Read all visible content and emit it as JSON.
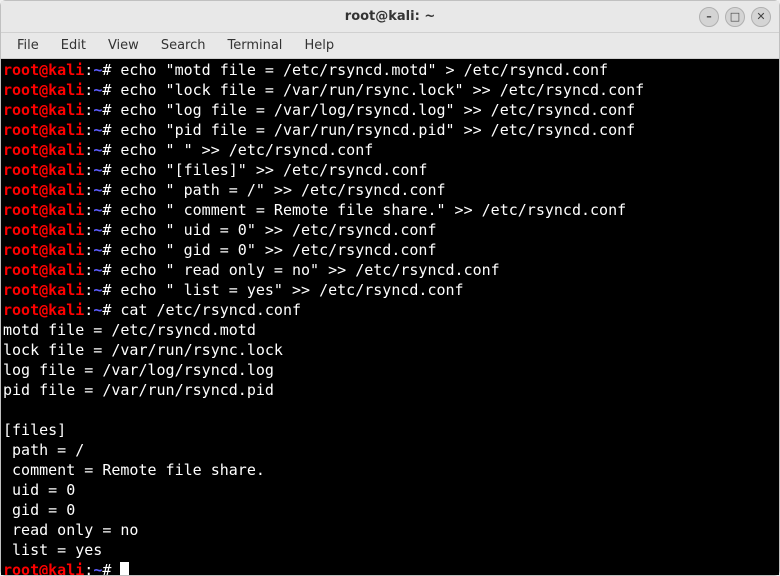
{
  "window": {
    "title": "root@kali: ~"
  },
  "menubar": {
    "items": [
      "File",
      "Edit",
      "View",
      "Search",
      "Terminal",
      "Help"
    ]
  },
  "prompt": {
    "user_host": "root@kali",
    "colon": ":",
    "path": "~",
    "hash": "#"
  },
  "commands": [
    "echo \"motd file = /etc/rsyncd.motd\" > /etc/rsyncd.conf",
    "echo \"lock file = /var/run/rsync.lock\" >> /etc/rsyncd.conf",
    "echo \"log file = /var/log/rsyncd.log\" >> /etc/rsyncd.conf",
    "echo \"pid file = /var/run/rsyncd.pid\" >> /etc/rsyncd.conf",
    "echo \" \" >> /etc/rsyncd.conf",
    "echo \"[files]\" >> /etc/rsyncd.conf",
    "echo \" path = /\" >> /etc/rsyncd.conf",
    "echo \" comment = Remote file share.\" >> /etc/rsyncd.conf",
    "echo \" uid = 0\" >> /etc/rsyncd.conf",
    "echo \" gid = 0\" >> /etc/rsyncd.conf",
    "echo \" read only = no\" >> /etc/rsyncd.conf",
    "echo \" list = yes\" >> /etc/rsyncd.conf",
    "cat /etc/rsyncd.conf"
  ],
  "output": [
    "motd file = /etc/rsyncd.motd",
    "lock file = /var/run/rsync.lock",
    "log file = /var/log/rsyncd.log",
    "pid file = /var/run/rsyncd.pid",
    " ",
    "[files]",
    " path = /",
    " comment = Remote file share.",
    " uid = 0",
    " gid = 0",
    " read only = no",
    " list = yes"
  ],
  "controls": {
    "minimize": "–",
    "maximize": "□",
    "close": "✕"
  }
}
